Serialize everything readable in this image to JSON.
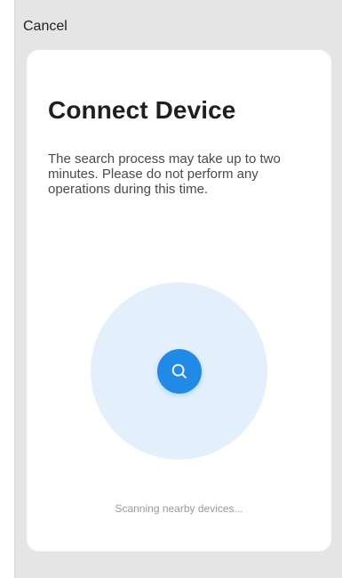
{
  "header": {
    "cancel_label": "Cancel"
  },
  "card": {
    "title": "Connect Device",
    "description": "The search process may take up to two minutes. Please do not perform any operations during this time.",
    "search_icon": "search-icon",
    "status_text": "Scanning nearby devices..."
  },
  "colors": {
    "accent": "#2189e6",
    "radar_fill": "#e3f0fc",
    "background": "#e5e5e5",
    "card": "#ffffff"
  }
}
